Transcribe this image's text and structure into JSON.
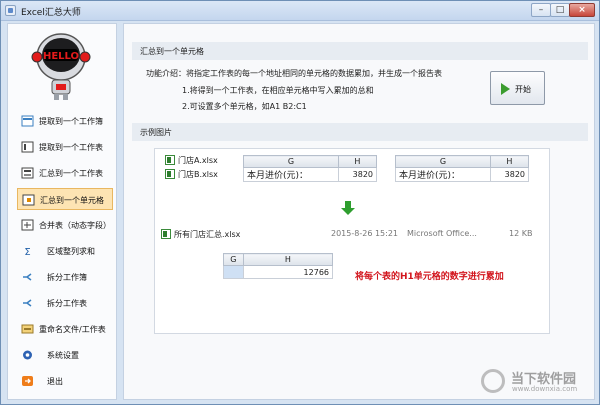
{
  "window": {
    "title": "Excel汇总大师"
  },
  "sidebar": {
    "items": [
      {
        "label": "提取到一个工作簿",
        "icon": "excel-extract-icon"
      },
      {
        "label": "提取到一个工作表",
        "icon": "sheet-extract-icon"
      },
      {
        "label": "汇总到一个工作表",
        "icon": "sheet-summary-icon"
      },
      {
        "label": "汇总到一个单元格",
        "icon": "cell-summary-icon"
      },
      {
        "label": "合并表（动态字段）",
        "icon": "merge-table-icon"
      },
      {
        "label": "区域整列求和",
        "icon": "column-sum-icon"
      },
      {
        "label": "拆分工作簿",
        "icon": "split-workbook-icon"
      },
      {
        "label": "拆分工作表",
        "icon": "split-sheet-icon"
      },
      {
        "label": "重命名文件/工作表",
        "icon": "rename-icon"
      },
      {
        "label": "系统设置",
        "icon": "settings-icon"
      },
      {
        "label": "退出",
        "icon": "exit-icon"
      }
    ]
  },
  "main": {
    "section_title": "汇总到一个单元格",
    "desc_intro": "功能介绍：将指定工作表的每一个地址相同的单元格的数据累加，并生成一个报告表",
    "desc_1": "1.将得到一个工作表，在相应单元格中写入累加的总和",
    "desc_2": "2.可设置多个单元格，如A1    B2:C1",
    "start_button": "开始",
    "example_title": "示例图片"
  },
  "example": {
    "file_a": "门店A.xlsx",
    "file_b": "门店B.xlsx",
    "col_g": "G",
    "col_h": "H",
    "label": "本月进价(元)：",
    "value": "3820",
    "summary_file": "所有门店汇总.xlsx",
    "summary_date": "2015-8-26 15:21",
    "summary_type": "Microsoft Office...",
    "summary_size": "12 KB",
    "sum_value": "12766",
    "note": "将每个表的H1单元格的数字进行累加"
  },
  "watermark": {
    "line1": "当下软件园",
    "line2": "www.downxia.com"
  }
}
